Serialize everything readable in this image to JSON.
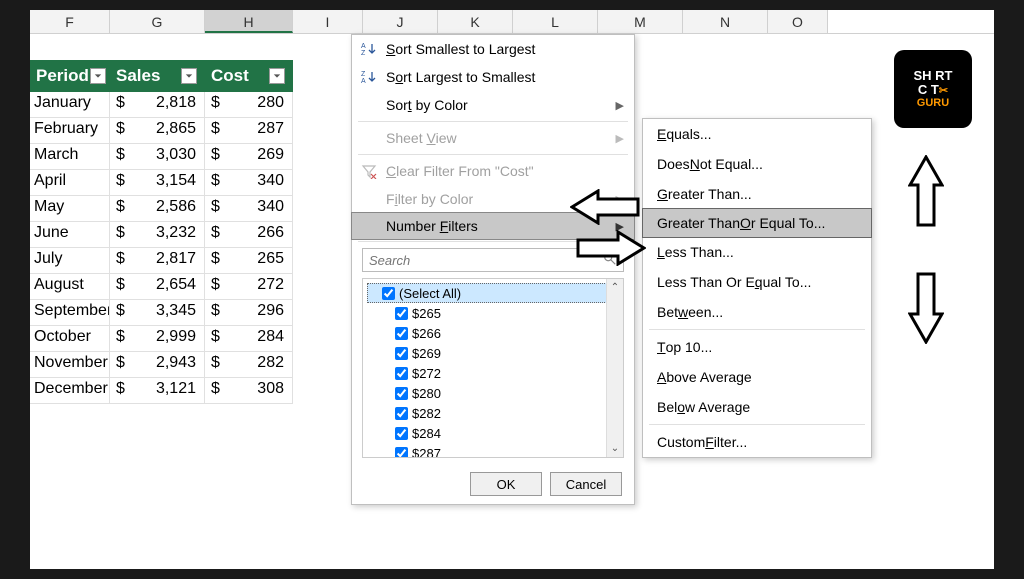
{
  "columns": [
    "F",
    "G",
    "H",
    "I",
    "J",
    "K",
    "L",
    "M",
    "N",
    "O"
  ],
  "headers": {
    "period": "Period",
    "sales": "Sales",
    "cost": "Cost"
  },
  "rows": [
    {
      "period": "January",
      "sales": "2,818",
      "cost": "280"
    },
    {
      "period": "February",
      "sales": "2,865",
      "cost": "287"
    },
    {
      "period": "March",
      "sales": "3,030",
      "cost": "269"
    },
    {
      "period": "April",
      "sales": "3,154",
      "cost": "340"
    },
    {
      "period": "May",
      "sales": "2,586",
      "cost": "340"
    },
    {
      "period": "June",
      "sales": "3,232",
      "cost": "266"
    },
    {
      "period": "July",
      "sales": "2,817",
      "cost": "265"
    },
    {
      "period": "August",
      "sales": "2,654",
      "cost": "272"
    },
    {
      "period": "September",
      "sales": "3,345",
      "cost": "296"
    },
    {
      "period": "October",
      "sales": "2,999",
      "cost": "284"
    },
    {
      "period": "November",
      "sales": "2,943",
      "cost": "282"
    },
    {
      "period": "December",
      "sales": "3,121",
      "cost": "308"
    }
  ],
  "menu1": {
    "sortAsc": "Sort Smallest to Largest",
    "sortDesc": "Sort Largest to Smallest",
    "sortColor": "Sort by Color",
    "sheetView": "Sheet View",
    "clearFilter": "Clear Filter From \"Cost\"",
    "filterColor": "Filter by Color",
    "numberFilters": "Number Filters",
    "searchPlaceholder": "Search",
    "selectAll": "(Select All)",
    "values": [
      "$265",
      "$266",
      "$269",
      "$272",
      "$280",
      "$282",
      "$284",
      "$287"
    ],
    "ok": "OK",
    "cancel": "Cancel"
  },
  "menu2": {
    "equals": "Equals...",
    "notEqual": "Does Not Equal...",
    "gt": "Greater Than...",
    "gte": "Greater Than Or Equal To...",
    "lt": "Less Than...",
    "lte": "Less Than Or Equal To...",
    "between": "Between...",
    "top10": "Top 10...",
    "above": "Above Average",
    "below": "Below Average",
    "custom": "Custom Filter..."
  },
  "logo": {
    "l1": "SH RT",
    "l2": "C T",
    "l3": "GURU"
  }
}
